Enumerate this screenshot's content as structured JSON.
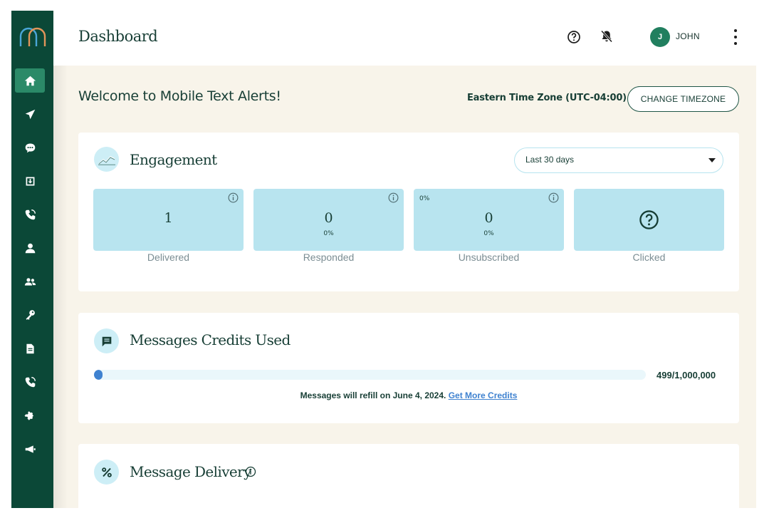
{
  "header": {
    "title": "Dashboard",
    "user_initial": "J",
    "user_name": "JOHN"
  },
  "sidebar": {
    "items": [
      {
        "icon": "home-icon",
        "active": true
      },
      {
        "icon": "send-icon",
        "active": false
      },
      {
        "icon": "chat-icon",
        "active": false
      },
      {
        "icon": "inbox-icon",
        "active": false
      },
      {
        "icon": "phone-icon",
        "active": false
      },
      {
        "icon": "user-icon",
        "active": false
      },
      {
        "icon": "group-icon",
        "active": false
      },
      {
        "icon": "key-icon",
        "active": false
      },
      {
        "icon": "document-icon",
        "active": false
      },
      {
        "icon": "phone-call-icon",
        "active": false
      },
      {
        "icon": "puzzle-icon",
        "active": false
      },
      {
        "icon": "megaphone-icon",
        "active": false
      }
    ]
  },
  "welcome": {
    "text": "Welcome to Mobile Text Alerts!",
    "timezone": "Eastern Time Zone (UTC-04:00)",
    "change_timezone": "CHANGE TIMEZONE"
  },
  "engagement": {
    "title": "Engagement",
    "range": "Last 30 days",
    "metrics": [
      {
        "label": "Delivered",
        "value": "1",
        "pct": ""
      },
      {
        "label": "Responded",
        "value": "0",
        "pct": "0%"
      },
      {
        "label": "Unsubscribed",
        "value": "0",
        "pct": "0%",
        "pct_corner": "0%"
      },
      {
        "label": "Clicked",
        "value": "",
        "icon": "question-circle-icon"
      }
    ]
  },
  "credits": {
    "title": "Messages Credits Used",
    "used_text": "499/1,000,000",
    "used_fraction": 0.000499,
    "refill_text": "Messages will refill on June 4, 2024.",
    "refill_link": "Get More Credits"
  },
  "delivery": {
    "title": "Message Delivery"
  },
  "colors": {
    "sidebar": "#0b4837",
    "sidebar_active": "#2b8a68",
    "metric_bg": "#b8e4ef",
    "accent_blue": "#3f82d0",
    "page_bg": "#f8f4ea"
  }
}
